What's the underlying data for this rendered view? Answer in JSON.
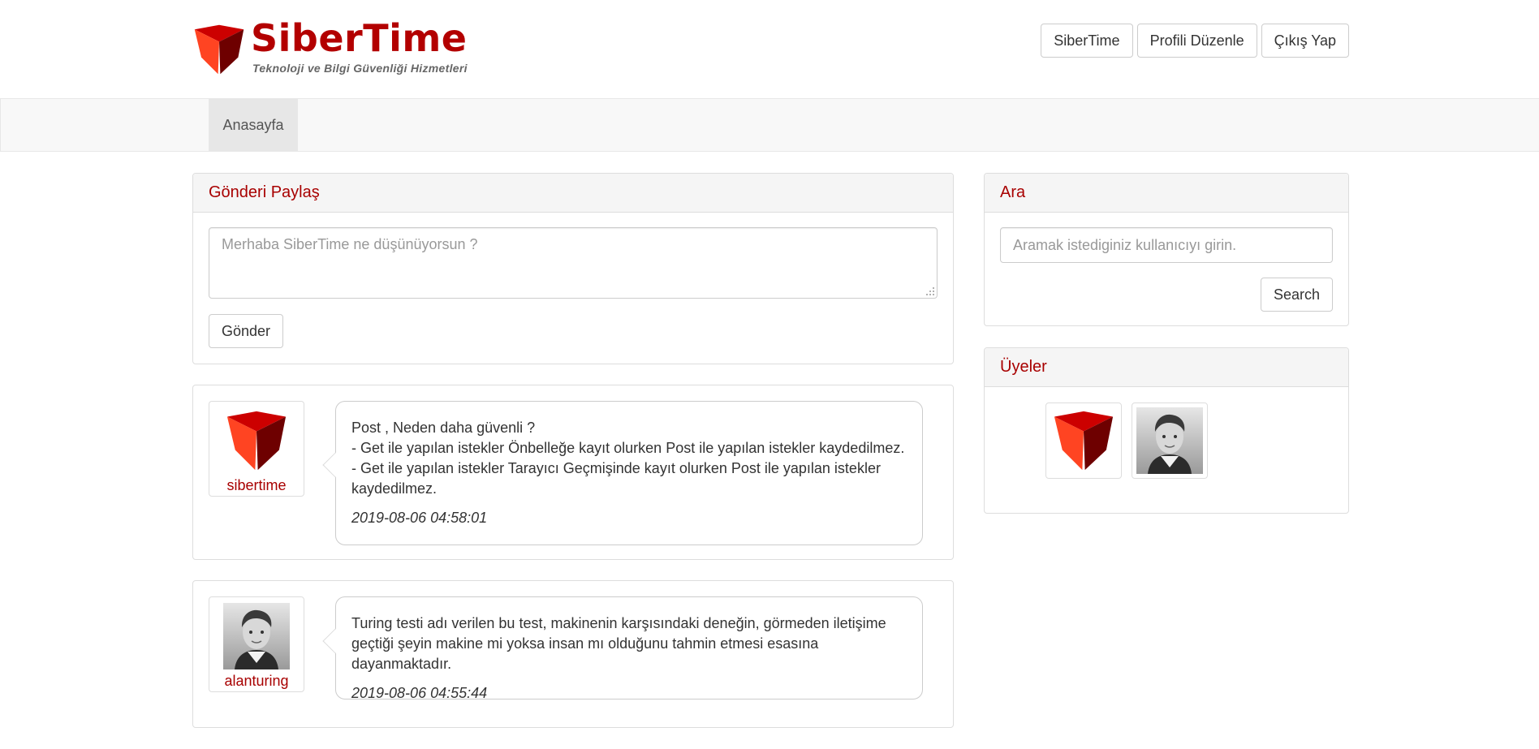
{
  "brand": {
    "name": "SiberTime",
    "tagline": "Teknoloji ve Bilgi Güvenliği Hizmetleri",
    "colors": {
      "primary": "#b30000",
      "dark": "#6e0000",
      "accent": "#ff4422"
    }
  },
  "header": {
    "buttons": [
      {
        "label": "SiberTime"
      },
      {
        "label": "Profili Düzenle"
      },
      {
        "label": "Çıkış Yap"
      }
    ]
  },
  "nav": {
    "items": [
      {
        "label": "Anasayfa",
        "active": true
      }
    ]
  },
  "share_panel": {
    "title": "Gönderi Paylaş",
    "placeholder": "Merhaba SiberTime ne düşünüyorsun ?",
    "submit_label": "Gönder"
  },
  "posts": [
    {
      "author": "sibertime",
      "avatar_icon": "sibertime-logo-icon",
      "text": "Post , Neden daha güvenli ?\n- Get ile yapılan istekler Önbelleğe kayıt olurken Post ile yapılan istekler kaydedilmez.\n- Get ile yapılan istekler Tarayıcı Geçmişinde kayıt olurken Post ile yapılan istekler kaydedilmez.",
      "timestamp": "2019-08-06 04:58:01"
    },
    {
      "author": "alanturing",
      "avatar_icon": "child-photo-icon",
      "text": "Turing testi adı verilen bu test, makinenin karşısındaki deneğin, görmeden iletişime geçtiği şeyin makine mi yoksa insan mı olduğunu tahmin etmesi esasına dayanmaktadır.",
      "timestamp": "2019-08-06 04:55:44"
    }
  ],
  "search_panel": {
    "title": "Ara",
    "placeholder": "Aramak istediginiz kullanıcıyı girin.",
    "button_label": "Search"
  },
  "members_panel": {
    "title": "Üyeler",
    "members": [
      {
        "icon": "sibertime-logo-icon"
      },
      {
        "icon": "child-photo-icon"
      }
    ]
  }
}
